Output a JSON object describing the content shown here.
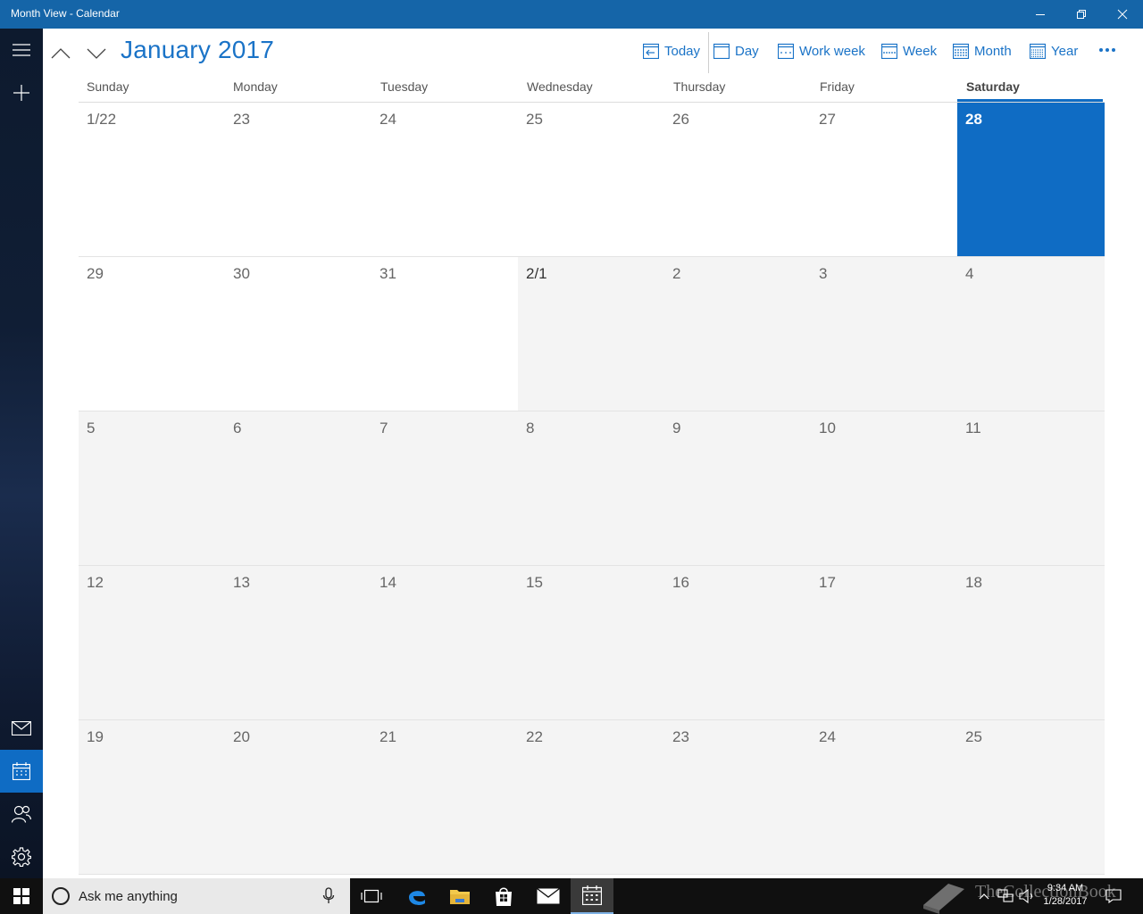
{
  "window": {
    "title": "Month View - Calendar",
    "controls": [
      "minimize-icon",
      "restore-icon",
      "close-icon"
    ]
  },
  "rail": {
    "items": [
      {
        "name": "hamburger-menu",
        "icon": "hamburger-icon"
      },
      {
        "name": "new-event",
        "icon": "plus-icon"
      },
      {
        "name": "mail",
        "icon": "mail-icon"
      },
      {
        "name": "calendar",
        "icon": "calendar-icon",
        "active": true
      },
      {
        "name": "people",
        "icon": "people-icon"
      },
      {
        "name": "settings",
        "icon": "gear-icon"
      }
    ]
  },
  "header": {
    "title": "January 2017",
    "views": [
      {
        "label": "Today",
        "icon": "today-icon"
      },
      {
        "label": "Day",
        "icon": "day-icon"
      },
      {
        "label": "Work week",
        "icon": "work-week-icon"
      },
      {
        "label": "Week",
        "icon": "week-icon"
      },
      {
        "label": "Month",
        "icon": "month-icon"
      },
      {
        "label": "Year",
        "icon": "year-icon"
      }
    ],
    "more_icon": "more-icon"
  },
  "weekdays": [
    "Sunday",
    "Monday",
    "Tuesday",
    "Wednesday",
    "Thursday",
    "Friday",
    "Saturday"
  ],
  "selected_weekday": "Saturday",
  "weeks": [
    [
      "1/22",
      "23",
      "24",
      "25",
      "26",
      "27",
      "28"
    ],
    [
      "29",
      "30",
      "31",
      "2/1",
      "2",
      "3",
      "4"
    ],
    [
      "5",
      "6",
      "7",
      "8",
      "9",
      "10",
      "11"
    ],
    [
      "12",
      "13",
      "14",
      "15",
      "16",
      "17",
      "18"
    ],
    [
      "19",
      "20",
      "21",
      "22",
      "23",
      "24",
      "25"
    ]
  ],
  "today": "28",
  "colors": {
    "accent": "#0f6cc4",
    "titlebar": "#1565a8",
    "link": "#1a73c7",
    "other_month_bg": "#f4f4f4"
  },
  "taskbar": {
    "search_placeholder": "Ask me anything",
    "apps": [
      "task-view-icon",
      "edge-icon",
      "file-explorer-icon",
      "store-icon",
      "mail-icon",
      "calendar-icon"
    ],
    "time": "9:34 AM",
    "date": "1/28/2017",
    "watermark": "TheCollectionBook"
  }
}
